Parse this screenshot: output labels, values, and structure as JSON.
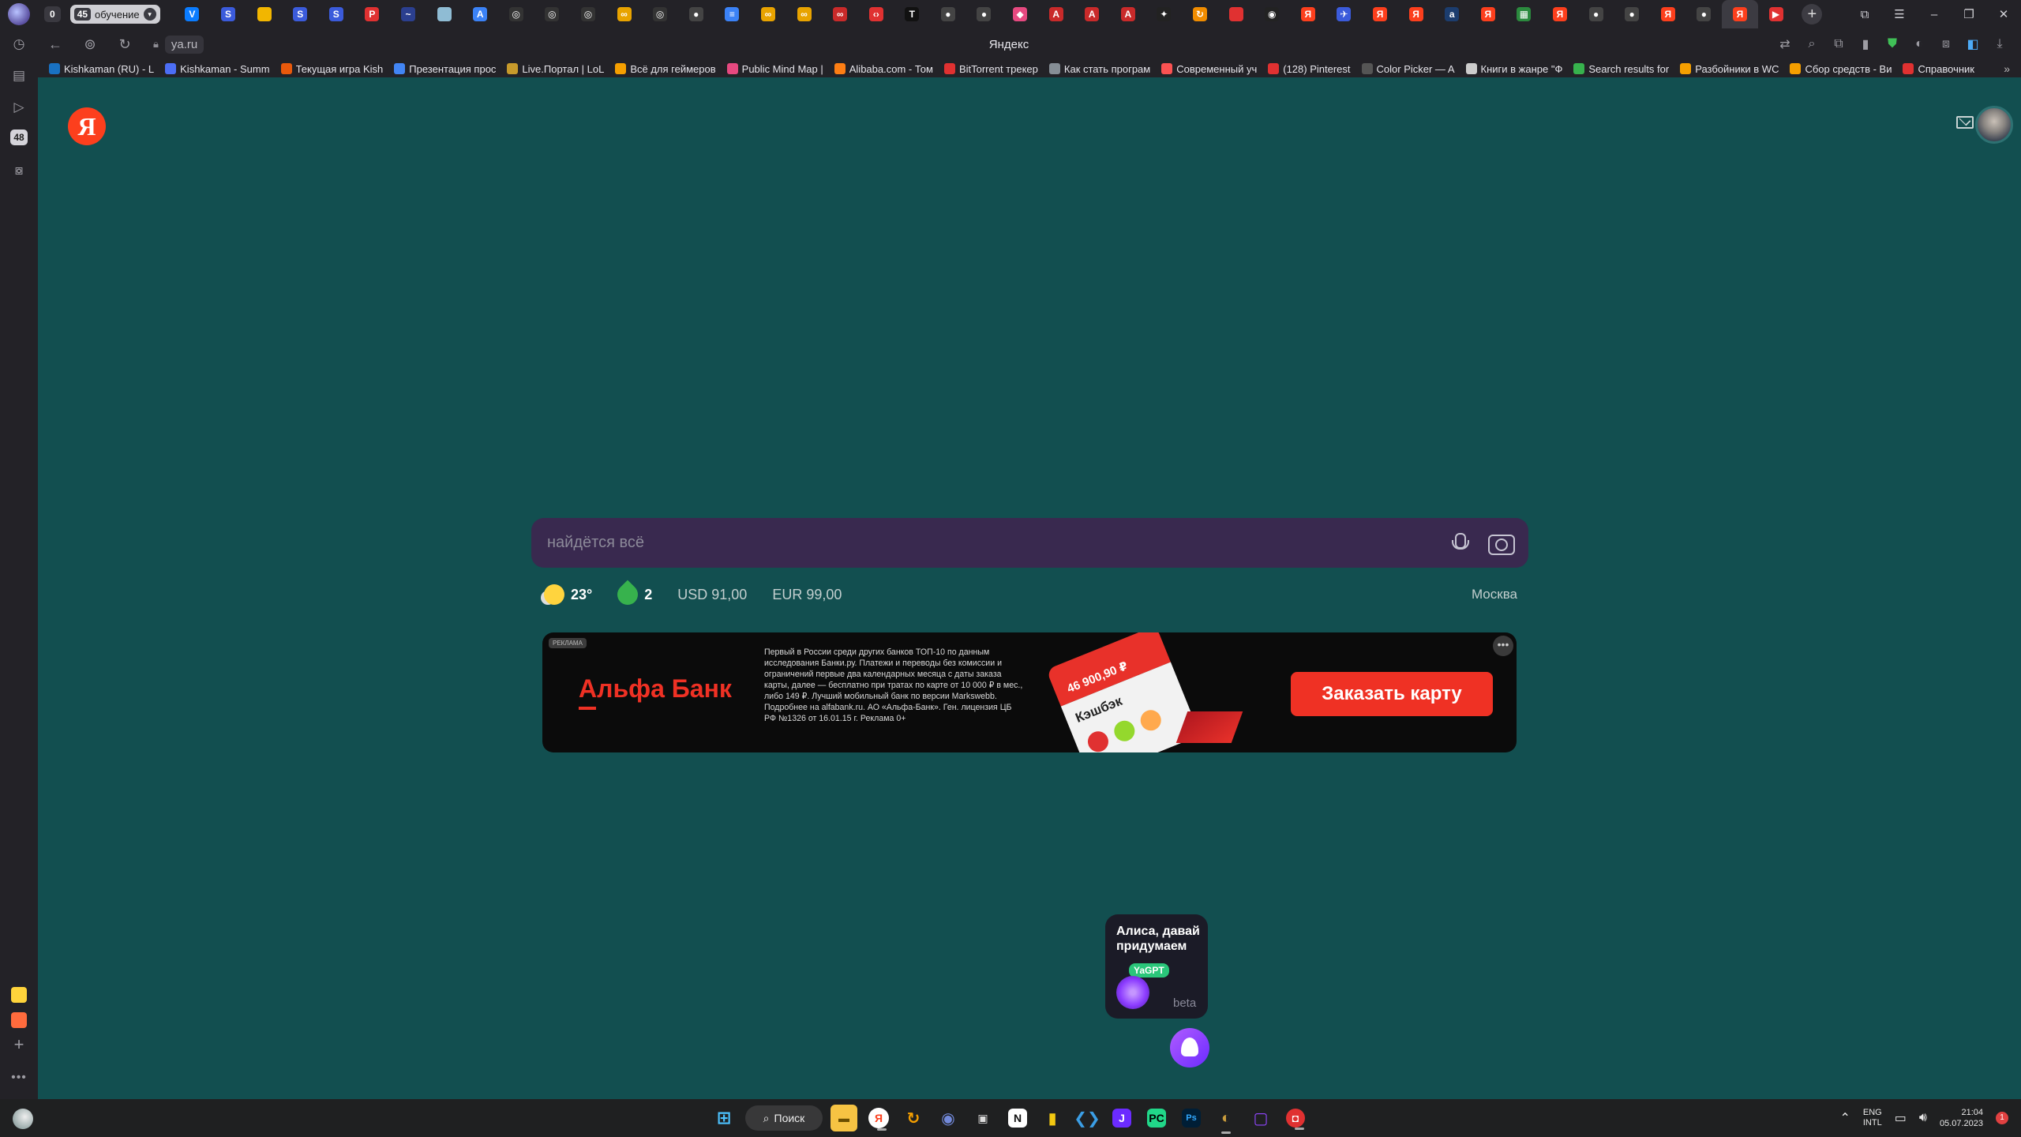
{
  "browser": {
    "tab_counter": "0",
    "tab_group": {
      "count": "45",
      "label": "обучение"
    },
    "tabs": [
      {
        "icon": "vk-icon",
        "glyph": "V",
        "color": "#0a7cff"
      },
      {
        "icon": "skype-icon",
        "glyph": "S",
        "color": "#3b5bdb"
      },
      {
        "icon": "microsoft-icon",
        "glyph": "",
        "color": "#f2b600"
      },
      {
        "icon": "skype-icon",
        "glyph": "S",
        "color": "#3b5bdb"
      },
      {
        "icon": "skype-icon",
        "glyph": "S",
        "color": "#3b5bdb"
      },
      {
        "icon": "pdf-icon",
        "glyph": "P",
        "color": "#e03131"
      },
      {
        "icon": "dash-icon",
        "glyph": "~",
        "color": "#2b3f8f"
      },
      {
        "icon": "app-icon",
        "glyph": "",
        "color": "#8fbcd4"
      },
      {
        "icon": "a-icon",
        "glyph": "A",
        "color": "#3b82f6"
      },
      {
        "icon": "openai-icon",
        "glyph": "◎",
        "color": "#333"
      },
      {
        "icon": "openai-icon",
        "glyph": "◎",
        "color": "#333"
      },
      {
        "icon": "openai-icon",
        "glyph": "◎",
        "color": "#333"
      },
      {
        "icon": "loop-icon",
        "glyph": "∞",
        "color": "#e8a300"
      },
      {
        "icon": "openai-icon",
        "glyph": "◎",
        "color": "#333"
      },
      {
        "icon": "github-icon",
        "glyph": "●",
        "color": "#444"
      },
      {
        "icon": "list-icon",
        "glyph": "≡",
        "color": "#3b82f6"
      },
      {
        "icon": "loop-icon",
        "glyph": "∞",
        "color": "#e8a300"
      },
      {
        "icon": "loop-icon",
        "glyph": "∞",
        "color": "#e8a300"
      },
      {
        "icon": "link-icon",
        "glyph": "∞",
        "color": "#c92a2a"
      },
      {
        "icon": "code-icon",
        "glyph": "‹›",
        "color": "#e03131"
      },
      {
        "icon": "text-icon",
        "glyph": "T",
        "color": "#111"
      },
      {
        "icon": "github-icon",
        "glyph": "●",
        "color": "#444"
      },
      {
        "icon": "github-icon",
        "glyph": "●",
        "color": "#444"
      },
      {
        "icon": "color-icon",
        "glyph": "◆",
        "color": "#e64980"
      },
      {
        "icon": "a-red-icon",
        "glyph": "A",
        "color": "#c92a2a"
      },
      {
        "icon": "a-red-icon",
        "glyph": "A",
        "color": "#c92a2a"
      },
      {
        "icon": "a-red-icon",
        "glyph": "A",
        "color": "#c92a2a"
      },
      {
        "icon": "sparkle-icon",
        "glyph": "✦",
        "color": "#222"
      },
      {
        "icon": "refresh-icon",
        "glyph": "↻",
        "color": "#f08c00"
      },
      {
        "icon": "red-square-icon",
        "glyph": "",
        "color": "#e03131"
      },
      {
        "icon": "eye-icon",
        "glyph": "◉",
        "color": "#222"
      },
      {
        "icon": "yandex-icon",
        "glyph": "Я",
        "color": "#fc3f1d"
      },
      {
        "icon": "plane-icon",
        "glyph": "✈",
        "color": "#3b5bdb"
      },
      {
        "icon": "yandex-icon",
        "glyph": "Я",
        "color": "#fc3f1d"
      },
      {
        "icon": "yandex-icon",
        "glyph": "Я",
        "color": "#fc3f1d"
      },
      {
        "icon": "doc-icon",
        "glyph": "a",
        "color": "#1c3d6e"
      },
      {
        "icon": "yandex-icon",
        "glyph": "Я",
        "color": "#fc3f1d"
      },
      {
        "icon": "sheets-icon",
        "glyph": "▦",
        "color": "#2b8a3e"
      },
      {
        "icon": "yandex-icon",
        "glyph": "Я",
        "color": "#fc3f1d"
      },
      {
        "icon": "github-icon",
        "glyph": "●",
        "color": "#444"
      },
      {
        "icon": "github-icon",
        "glyph": "●",
        "color": "#444"
      },
      {
        "icon": "yandex-icon",
        "glyph": "Я",
        "color": "#fc3f1d"
      },
      {
        "icon": "github-icon",
        "glyph": "●",
        "color": "#444"
      },
      {
        "icon": "yandex-icon",
        "glyph": "Я",
        "color": "#fc3f1d",
        "active": true
      },
      {
        "icon": "youtube-icon",
        "glyph": "▶",
        "color": "#e03131"
      }
    ],
    "url": "ya.ru",
    "page_title": "Яндекс",
    "bookmarks": [
      {
        "label": "Kishkaman (RU) - L",
        "color": "#1971c2"
      },
      {
        "label": "Kishkaman - Summ",
        "color": "#4c6ef5"
      },
      {
        "label": "Текущая игра Kish",
        "color": "#e8590c"
      },
      {
        "label": "Презентация прос",
        "color": "#4285f4"
      },
      {
        "label": "Live.Портал | LoL",
        "color": "#c79a2b"
      },
      {
        "label": "Всё для геймеров",
        "color": "#f59f00"
      },
      {
        "label": "Public Mind Map |",
        "color": "#e64980"
      },
      {
        "label": "Alibaba.com - Том",
        "color": "#fd7e14"
      },
      {
        "label": "BitTorrent трекер",
        "color": "#e03131"
      },
      {
        "label": "Как стать програм",
        "color": "#868e96"
      },
      {
        "label": "Современный уч",
        "color": "#fa5252"
      },
      {
        "label": "(128) Pinterest",
        "color": "#e03131"
      },
      {
        "label": "Color Picker — A",
        "color": "#555"
      },
      {
        "label": "Книги в жанре \"Ф",
        "color": "#ccc"
      },
      {
        "label": "Search results for",
        "color": "#37b24d"
      },
      {
        "label": "Разбойники в WC",
        "color": "#f59f00"
      },
      {
        "label": "Сбор средств - Ви",
        "color": "#f59f00"
      },
      {
        "label": "Справочник",
        "color": "#e03131"
      }
    ]
  },
  "page": {
    "logo": "Я",
    "search": {
      "placeholder": "найдётся всё"
    },
    "informers": {
      "temperature": "23°",
      "traffic": "2",
      "usd": "USD 91,00",
      "eur": "EUR 99,00",
      "city": "Москва"
    },
    "ad": {
      "tag": "РЕКЛАМА",
      "brand": "Альфа Банк",
      "legal": "Первый в России среди других банков ТОП-10 по данным исследования Банки.ру. Платежи и переводы без комиссии и ограничений первые два календарных месяца с даты заказа карты, далее — бесплатно при тратах по карте от 10 000 ₽ в мес., либо 149 ₽. Лучший мобильный банк по версии Markswebb. Подробнее на alfabank.ru. АО «Альфа-Банк». Ген. лицензия ЦБ РФ №1326 от 16.01.15 г. Реклама 0+",
      "card_amount": "46 900,90 ₽",
      "card_label": "Кэшбэк",
      "cta": "Заказать карту"
    },
    "alice": {
      "title": "Алиса, давай придумаем",
      "badge": "YaGPT",
      "beta": "beta"
    }
  },
  "taskbar": {
    "search_label": "Поиск",
    "lang_top": "ENG",
    "lang_bottom": "INTL",
    "time": "21:04",
    "date": "05.07.2023",
    "notifications": "1"
  }
}
